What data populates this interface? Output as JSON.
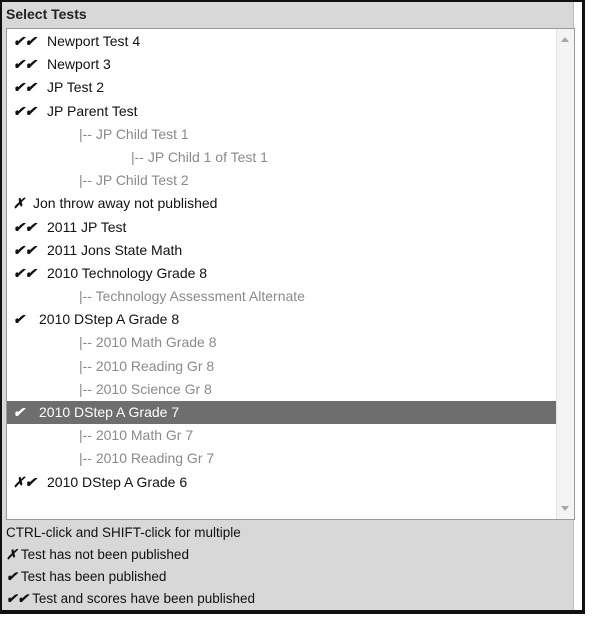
{
  "panel": {
    "title": "Select Tests"
  },
  "icons": {
    "scroll_up": "scroll-up-arrow-icon",
    "scroll_down": "scroll-down-arrow-icon"
  },
  "colors": {
    "selected_bg": "#6e6e6e",
    "child_text": "#8a8a8a",
    "panel_bg": "#d8d8d8"
  },
  "tests": [
    {
      "mark": "✔✔",
      "label": "Newport Test 4",
      "level": 0
    },
    {
      "mark": "✔✔",
      "label": "Newport 3",
      "level": 0
    },
    {
      "mark": "✔✔",
      "label": "JP Test 2",
      "level": 0
    },
    {
      "mark": "✔✔",
      "label": "JP Parent Test",
      "level": 0
    },
    {
      "mark": "",
      "label": "|-- JP Child Test 1",
      "level": 1
    },
    {
      "mark": "",
      "label": "|-- JP Child 1 of Test 1",
      "level": 2
    },
    {
      "mark": "",
      "label": "|-- JP Child Test 2",
      "level": 1
    },
    {
      "mark": "✗",
      "label": "Jon throw away not published",
      "level": 0
    },
    {
      "mark": "✔✔",
      "label": "2011 JP Test",
      "level": 0
    },
    {
      "mark": "✔✔",
      "label": "2011 Jons State Math",
      "level": 0
    },
    {
      "mark": "✔✔",
      "label": "2010 Technology Grade 8",
      "level": 0
    },
    {
      "mark": "",
      "label": "|-- Technology Assessment Alternate",
      "level": 1
    },
    {
      "mark": "✔",
      "label": "2010 DStep A Grade 8",
      "level": 0
    },
    {
      "mark": "",
      "label": "|-- 2010 Math Grade 8",
      "level": 1
    },
    {
      "mark": "",
      "label": "|-- 2010 Reading Gr 8",
      "level": 1
    },
    {
      "mark": "",
      "label": "|-- 2010 Science Gr 8",
      "level": 1
    },
    {
      "mark": "✔",
      "label": "2010 DStep A Grade 7",
      "level": 0,
      "selected": true
    },
    {
      "mark": "",
      "label": "|-- 2010 Math Gr 7",
      "level": 1
    },
    {
      "mark": "",
      "label": "|-- 2010 Reading Gr 7",
      "level": 1
    },
    {
      "mark": "✗✔",
      "label": "2010 DStep A Grade 6",
      "level": 0
    }
  ],
  "legend": {
    "hint": "CTRL-click and SHIFT-click for multiple",
    "not_published_symbol": "✗",
    "not_published": "Test has not been published",
    "published_symbol": "✔",
    "published": "Test has been published",
    "scores_published_symbol": "✔✔",
    "scores_published": "Test and scores have been published"
  }
}
